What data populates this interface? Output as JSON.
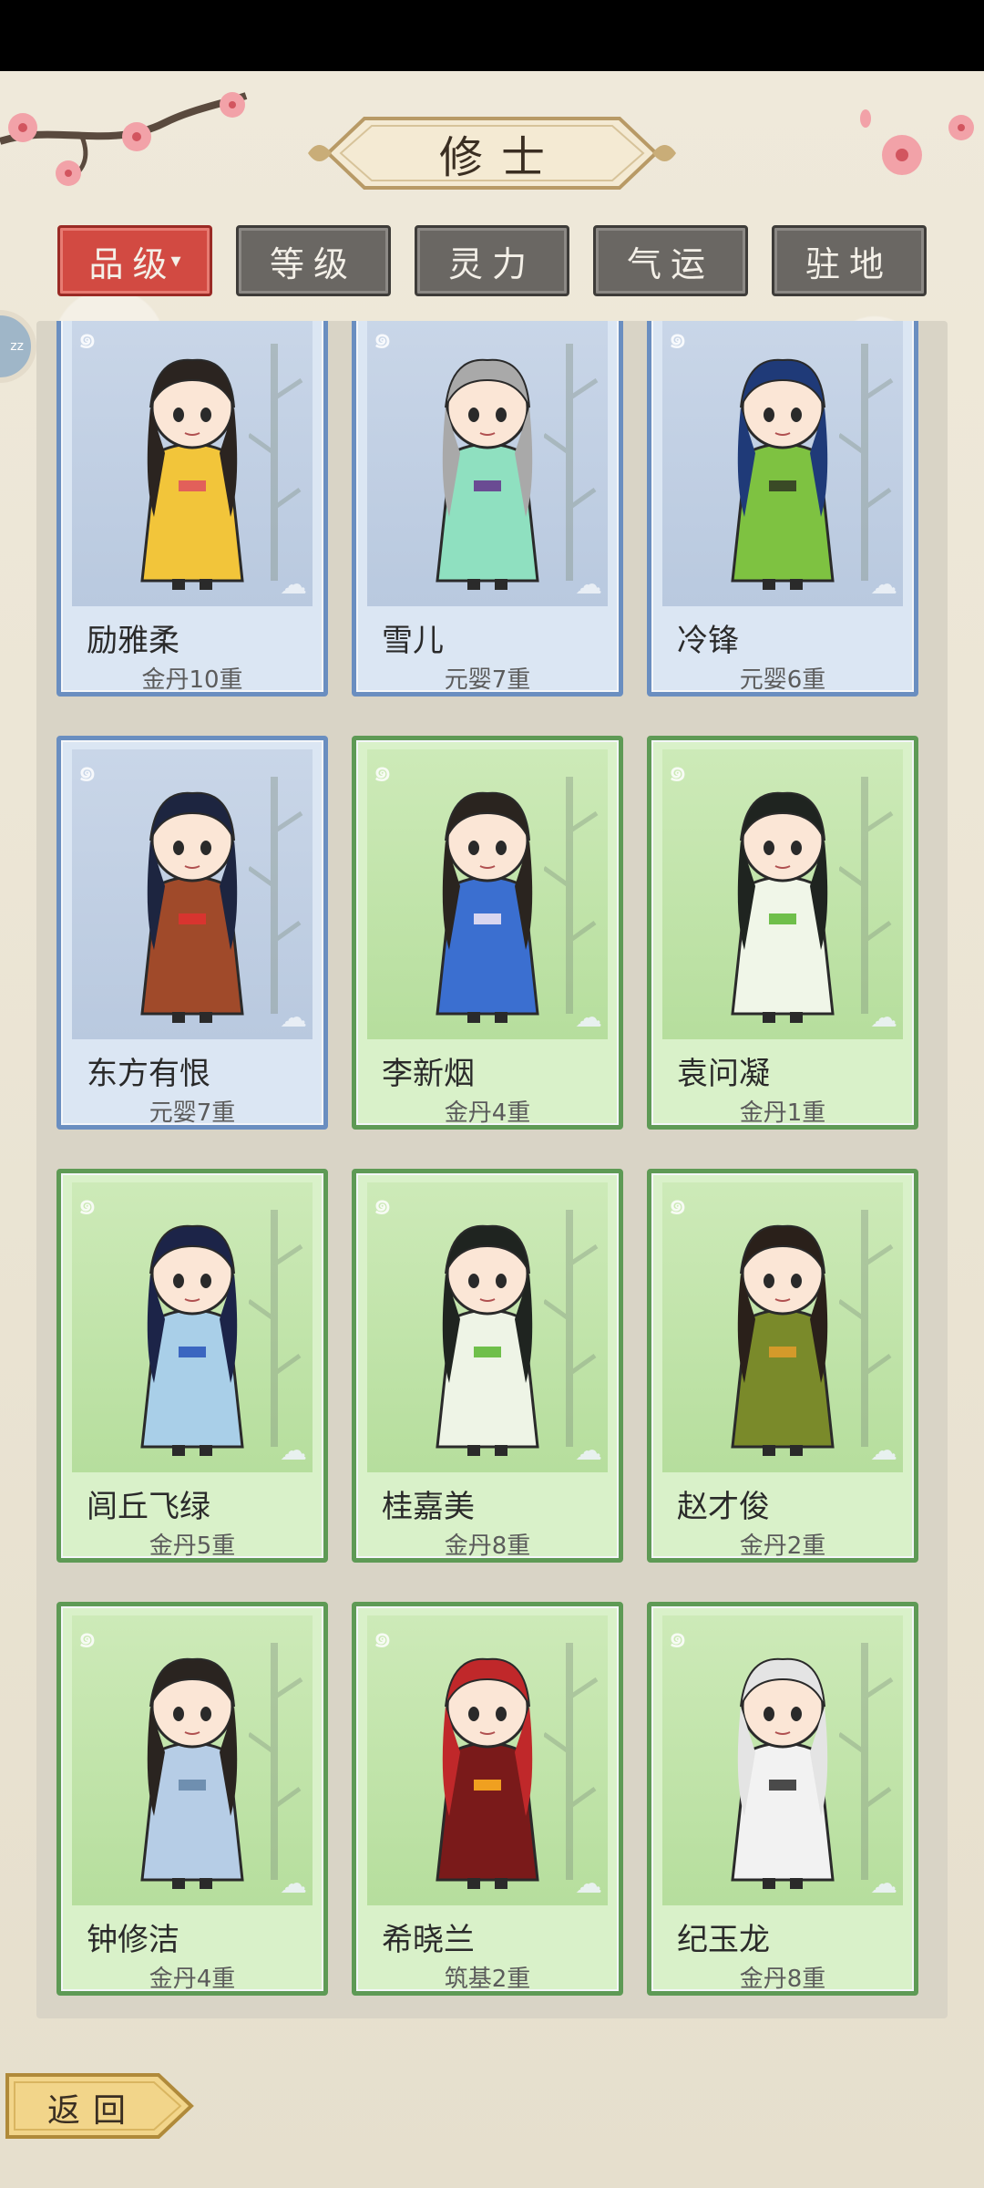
{
  "header": {
    "title": "修士"
  },
  "filters": [
    {
      "label": "品级",
      "caret": "▾",
      "active": true
    },
    {
      "label": "等级",
      "active": false
    },
    {
      "label": "灵力",
      "active": false
    },
    {
      "label": "气运",
      "active": false
    },
    {
      "label": "驻地",
      "active": false
    }
  ],
  "side_badge": {
    "text": "zz"
  },
  "cards": [
    {
      "name": "励雅柔",
      "level": "金丹10重",
      "frame": "blue",
      "hair": "#2b2420",
      "robe": "#f2c53a",
      "accent": "#e2605a"
    },
    {
      "name": "雪儿",
      "level": "元婴7重",
      "frame": "blue",
      "hair": "#a9a9a9",
      "robe": "#8fe0c0",
      "accent": "#6a4b93"
    },
    {
      "name": "冷锋",
      "level": "元婴6重",
      "frame": "blue",
      "hair": "#1f3a78",
      "robe": "#7ec241",
      "accent": "#3a4a26"
    },
    {
      "name": "东方有恨",
      "level": "元婴7重",
      "frame": "blue",
      "hair": "#1d2540",
      "robe": "#a04a2a",
      "accent": "#d8342f"
    },
    {
      "name": "李新烟",
      "level": "金丹4重",
      "frame": "green",
      "hair": "#2a241f",
      "robe": "#3b6fd0",
      "accent": "#d8d6f0"
    },
    {
      "name": "袁问凝",
      "level": "金丹1重",
      "frame": "green",
      "hair": "#1f2420",
      "robe": "#f0f6e8",
      "accent": "#6fbf4a"
    },
    {
      "name": "闾丘飞绿",
      "level": "金丹5重",
      "frame": "green",
      "hair": "#1c2448",
      "robe": "#a9cfe8",
      "accent": "#3b66c0"
    },
    {
      "name": "桂嘉美",
      "level": "金丹8重",
      "frame": "green",
      "hair": "#1f2420",
      "robe": "#eef4e6",
      "accent": "#6fbf4a"
    },
    {
      "name": "赵才俊",
      "level": "金丹2重",
      "frame": "green",
      "hair": "#2a201a",
      "robe": "#7a8a2a",
      "accent": "#d49a2a"
    },
    {
      "name": "钟修洁",
      "level": "金丹4重",
      "frame": "green",
      "hair": "#2a2420",
      "robe": "#b6cde6",
      "accent": "#6f8fb0"
    },
    {
      "name": "希晓兰",
      "level": "筑基2重",
      "frame": "green",
      "hair": "#c0282a",
      "robe": "#7a1a1a",
      "accent": "#f0a020"
    },
    {
      "name": "纪玉龙",
      "level": "金丹8重",
      "frame": "green",
      "hair": "#e4e4e4",
      "robe": "#f2f2f2",
      "accent": "#4a4a4a"
    }
  ],
  "footer": {
    "back_label": "返回"
  }
}
